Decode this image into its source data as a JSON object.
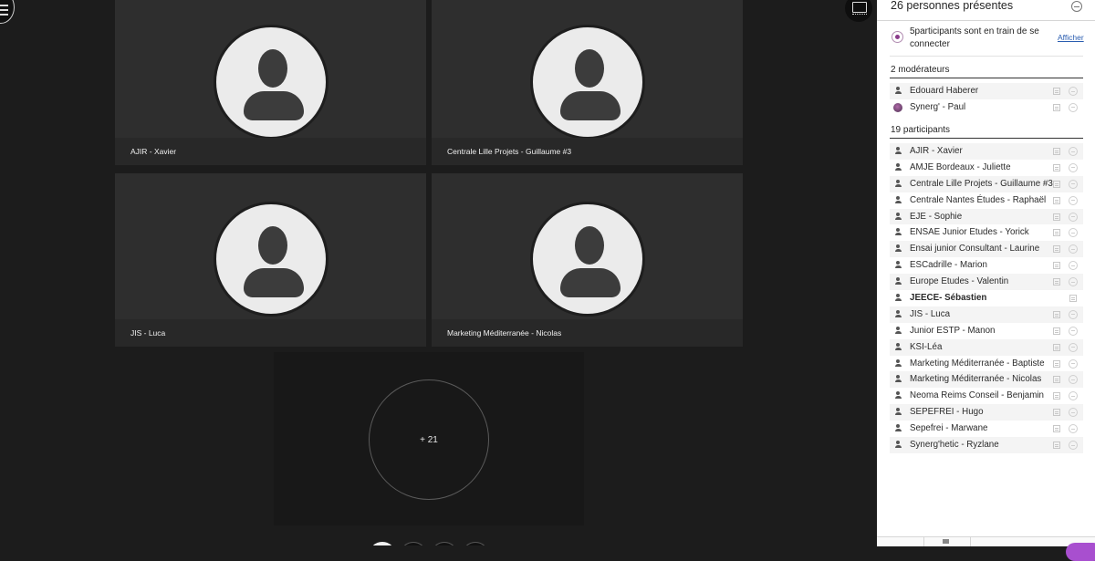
{
  "stage": {
    "tiles": [
      {
        "label": "AJIR - Xavier"
      },
      {
        "label": "Centrale Lille Projets - Guillaume #3"
      },
      {
        "label": "JIS - Luca"
      },
      {
        "label": "Marketing Méditerranée - Nicolas"
      }
    ],
    "overflow_count": "+ 21"
  },
  "panel": {
    "title": "26 personnes présentes",
    "connecting_text": "5participants sont en train de se connecter",
    "connecting_link": "Afficher",
    "moderators_heading": "2 modérateurs",
    "moderators": [
      {
        "name": "Edouard Haberer",
        "avatar": "person-icon"
      },
      {
        "name": "Synerg' - Paul",
        "avatar": "photo"
      }
    ],
    "participants_heading": "19 participants",
    "participants": [
      {
        "name": "AJIR - Xavier"
      },
      {
        "name": "AMJE Bordeaux - Juliette"
      },
      {
        "name": "Centrale Lille Projets - Guillaume #3"
      },
      {
        "name": "Centrale Nantes Études - Raphaël"
      },
      {
        "name": "EJE - Sophie"
      },
      {
        "name": "ENSAE Junior Etudes - Yorick"
      },
      {
        "name": "Ensai junior Consultant - Laurine"
      },
      {
        "name": "ESCadrille - Marion"
      },
      {
        "name": "Europe Etudes - Valentin"
      },
      {
        "name": "JEECE- Sébastien",
        "self": true
      },
      {
        "name": "JIS - Luca"
      },
      {
        "name": "Junior ESTP - Manon"
      },
      {
        "name": "KSI-Léa"
      },
      {
        "name": "Marketing Méditerranée - Baptiste"
      },
      {
        "name": "Marketing Méditerranée - Nicolas"
      },
      {
        "name": "Neoma Reims Conseil - Benjamin"
      },
      {
        "name": "SEPEFREI - Hugo"
      },
      {
        "name": "Sepefrei - Marwane"
      },
      {
        "name": "Synerg'hetic - Ryzlane"
      }
    ]
  },
  "colors": {
    "accent": "#a84fcf",
    "link": "#2a5db0",
    "stage_bg": "#1c1c1c",
    "tile_bg": "#2e2e2e"
  }
}
